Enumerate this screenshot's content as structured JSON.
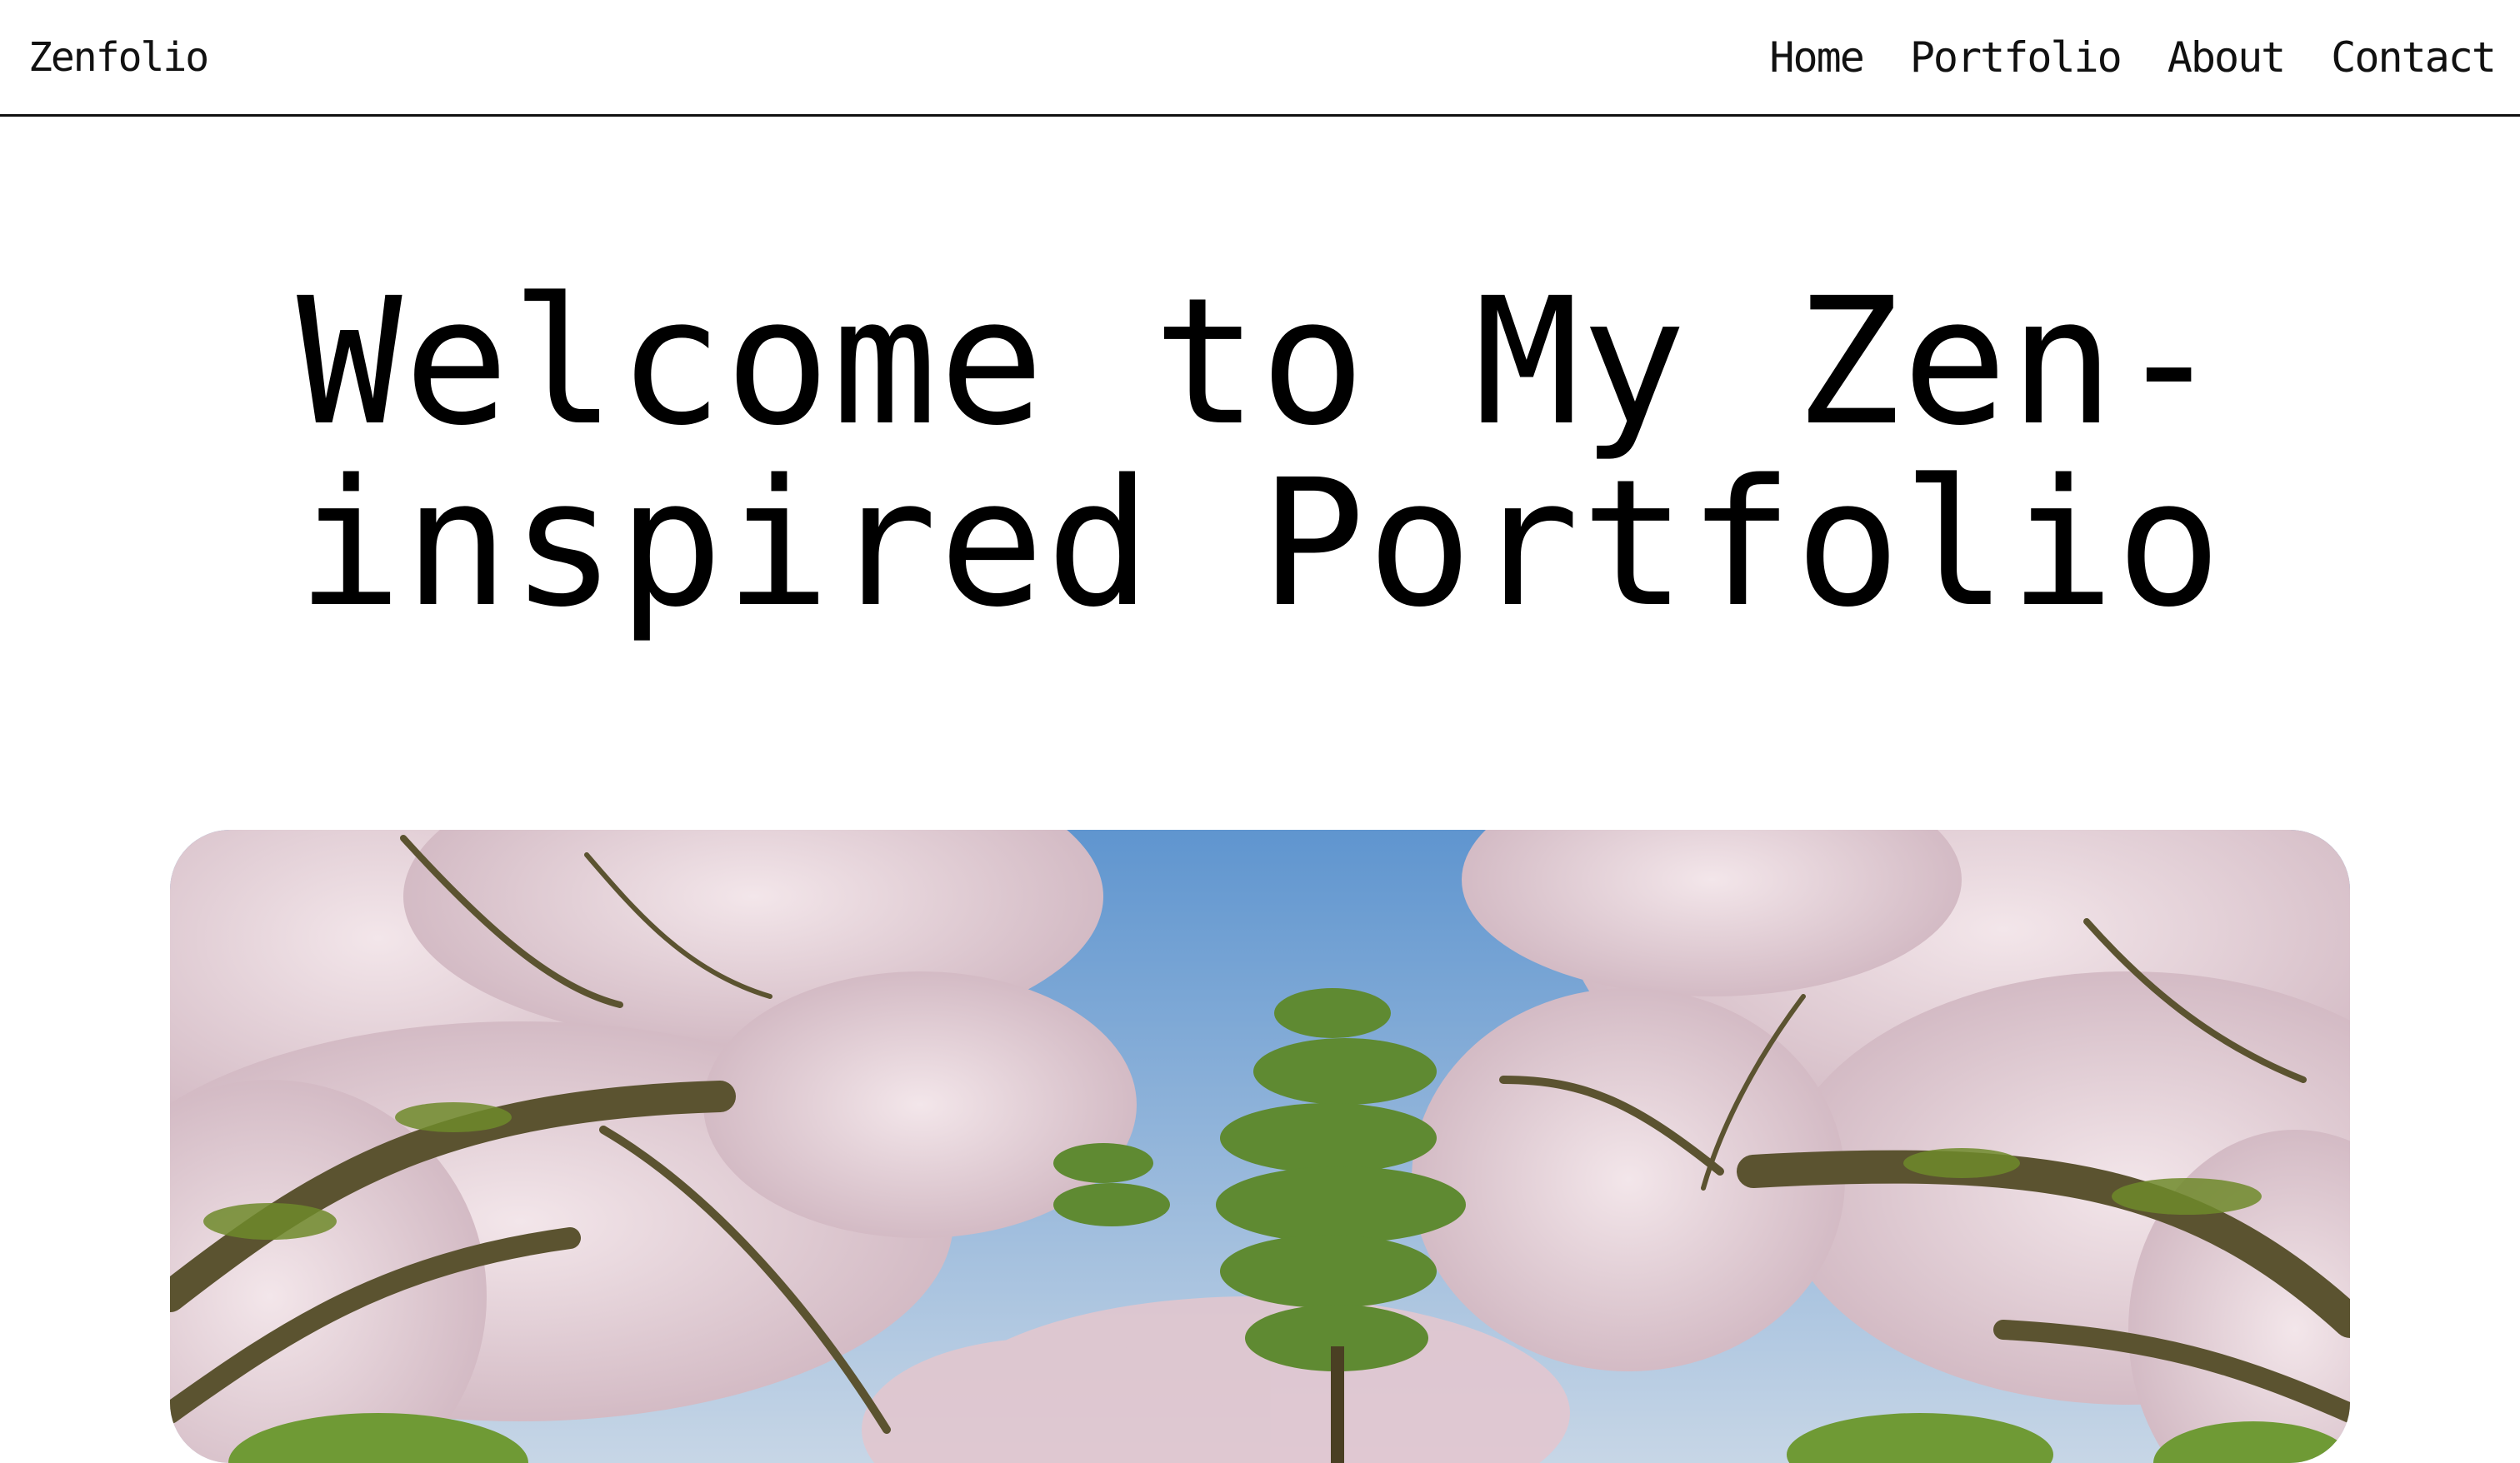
{
  "navbar": {
    "brand": "Zenfolio",
    "links": [
      "Home",
      "Portfolio",
      "About",
      "Contact"
    ]
  },
  "hero": {
    "title": "Welcome to My Zen-inspired Portfolio"
  },
  "image": {
    "subject": "cherry blossom garden",
    "colors": {
      "sky": "#8fb6dc",
      "blossom": "#e6d2d8",
      "branch": "#5b5330",
      "moss": "#6e8a2a",
      "pine": "#5f8a32"
    }
  }
}
